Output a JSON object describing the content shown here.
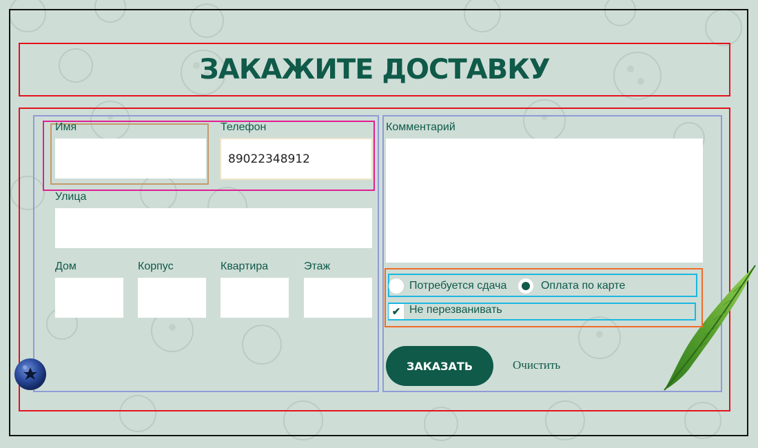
{
  "title": "ЗАКАЖИТЕ ДОСТАВКУ",
  "form": {
    "name": {
      "label": "Имя",
      "value": ""
    },
    "phone": {
      "label": "Телефон",
      "value": "89022348912"
    },
    "street": {
      "label": "Улица",
      "value": ""
    },
    "house": {
      "label": "Дом",
      "value": ""
    },
    "building": {
      "label": "Корпус",
      "value": ""
    },
    "apartment": {
      "label": "Квартира",
      "value": ""
    },
    "floor": {
      "label": "Этаж",
      "value": ""
    },
    "comment": {
      "label": "Комментарий",
      "value": ""
    },
    "options": {
      "change_needed": {
        "label": "Потребуется сдача",
        "selected": false
      },
      "card_payment": {
        "label": "Оплата по карте",
        "selected": true
      },
      "no_callback": {
        "label": "Не перезванивать",
        "checked": true
      }
    },
    "submit_label": "ЗАКАЗАТЬ",
    "reset_label": "Очистить"
  },
  "colors": {
    "background": "#cfddd7",
    "accent": "#0f5a49",
    "field": "#ffffff"
  },
  "icons": {
    "check": "check-icon",
    "decor_berry": "blueberry-icon",
    "decor_leaf": "leaf-icon"
  }
}
